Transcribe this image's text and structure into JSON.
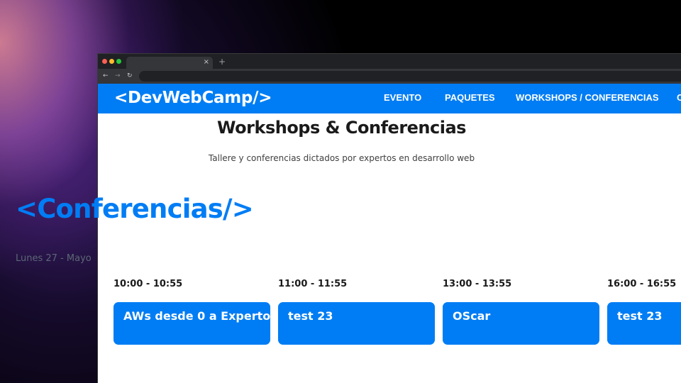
{
  "browser": {
    "tab_close_glyph": "×",
    "new_tab_glyph": "+",
    "back_glyph": "←",
    "forward_glyph": "→",
    "reload_glyph": "↻",
    "url": ""
  },
  "header": {
    "logo": "<DevWebCamp/>",
    "nav": [
      {
        "label": "EVENTO"
      },
      {
        "label": "PAQUETES"
      },
      {
        "label": "WORKSHOPS / CONFERENCIAS"
      },
      {
        "label": "C"
      }
    ]
  },
  "main": {
    "title": "Workshops & Conferencias",
    "subtitle": "Tallere y conferencias dictados por expertos en desarrollo web",
    "section_heading": "<Conferencias/>",
    "day": "Lunes 27 - Mayo",
    "slots": [
      {
        "time": "10:00 - 10:55",
        "title": "AWs desde 0 a Experto"
      },
      {
        "time": "11:00 - 11:55",
        "title": "test 23"
      },
      {
        "time": "13:00 - 13:55",
        "title": "OScar"
      },
      {
        "time": "16:00 - 16:55",
        "title": "test 23"
      }
    ]
  },
  "colors": {
    "brand_blue": "#007df4",
    "chrome_dark": "#202124",
    "chrome_mid": "#35363a"
  }
}
